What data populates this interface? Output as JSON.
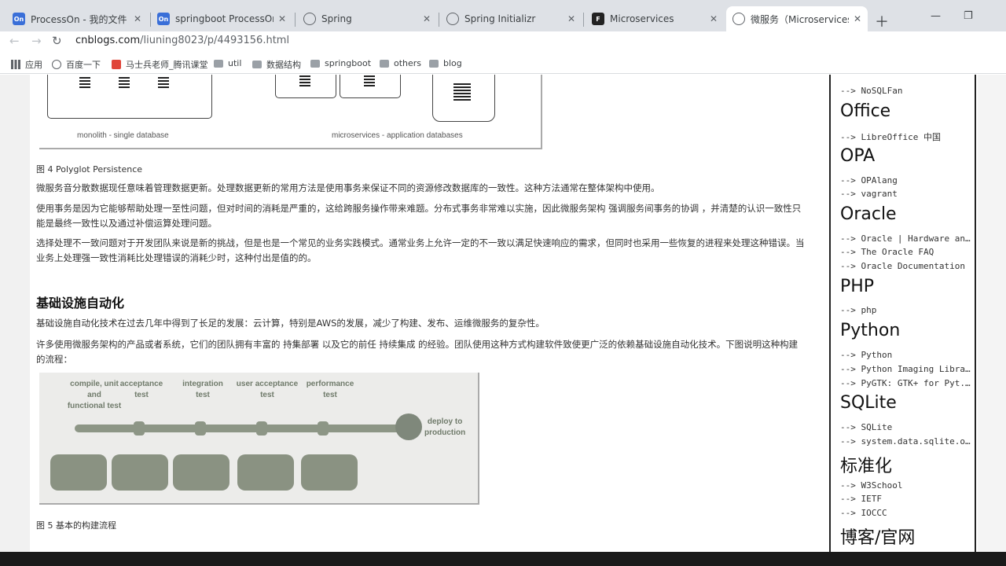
{
  "tabs": [
    {
      "title": "ProcessOn - 我的文件",
      "icon": "processon-icon"
    },
    {
      "title": "springboot ProcessOn Mi",
      "icon": "processon-icon"
    },
    {
      "title": "Spring",
      "icon": "globe-icon"
    },
    {
      "title": "Spring Initializr",
      "icon": "globe-icon"
    },
    {
      "title": "Microservices",
      "icon": "f-icon"
    },
    {
      "title": "微服务（Microservices）–",
      "icon": "globe-icon"
    }
  ],
  "address": {
    "host": "cnblogs.com",
    "path": "/liuning8023/p/4493156.html"
  },
  "bookmarks": [
    "应用",
    "百度一下",
    "马士兵老师_腾讯课堂",
    "util",
    "数据结构",
    "springboot",
    "others",
    "blog"
  ],
  "figure4": {
    "left_label": "monolith - single database",
    "right_label": "microservices - application databases",
    "caption": "图 4 Polyglot Persistence"
  },
  "paragraphs": [
    "微服务音分散数据现任意味着管理数据更新。处理数据更新的常用方法是使用事务来保证不同的资源修改数据库的一致性。这种方法通常在整体架构中使用。",
    "使用事务是因为它能够帮助处理一至性问题，但对时间的消耗是严重的，这给跨服务操作带来难题。分布式事务非常难以实施，因此微服务架构 强调服务间事务的协调 ，并清楚的认识一致性只能是最终一致性以及通过补偿运算处理问题。",
    "选择处理不一致问题对于开发团队来说是新的挑战，但是也是一个常见的业务实践模式。通常业务上允许一定的不一致以满足快速响应的需求，但同时也采用一些恢复的进程来处理这种错误。当业务上处理强一致性消耗比处理错误的消耗少时，这种付出是值的的。"
  ],
  "section": {
    "heading": "基础设施自动化",
    "para1": "基础设施自动化技术在过去几年中得到了长足的发展：云计算，特别是AWS的发展，减少了构建、发布、运维微服务的复杂性。",
    "para2": "许多使用微服务架构的产品或者系统，它们的团队拥有丰富的 持集部署 以及它的前任 持续集成 的经验。团队使用这种方式构建软件致使更广泛的依赖基础设施自动化技术。下图说明这种构建的流程："
  },
  "figure5": {
    "stages": [
      "compile, unit\nand\nfunctional test",
      "acceptance\ntest",
      "integration\ntest",
      "user acceptance\ntest",
      "performance\ntest"
    ],
    "deploy": "deploy to\nproduction",
    "caption": "图 5 基本的构建流程"
  },
  "sidebar": [
    {
      "type": "link",
      "text": "--> NoSQLFan"
    },
    {
      "type": "head",
      "text": "Office"
    },
    {
      "type": "link",
      "text": "--> LibreOffice 中国"
    },
    {
      "type": "head",
      "text": "OPA"
    },
    {
      "type": "link",
      "text": "--> OPAlang"
    },
    {
      "type": "link",
      "text": "--> vagrant"
    },
    {
      "type": "head",
      "text": "Oracle"
    },
    {
      "type": "link",
      "text": "--> Oracle | Hardware an..."
    },
    {
      "type": "link",
      "text": "--> The Oracle FAQ"
    },
    {
      "type": "link",
      "text": "--> Oracle Documentation"
    },
    {
      "type": "head",
      "text": "PHP"
    },
    {
      "type": "link",
      "text": "--> php"
    },
    {
      "type": "head",
      "text": "Python"
    },
    {
      "type": "link",
      "text": "--> Python"
    },
    {
      "type": "link",
      "text": "--> Python Imaging Libra..."
    },
    {
      "type": "link",
      "text": "--> PyGTK: GTK+ for Pyt..."
    },
    {
      "type": "head",
      "text": "SQLite"
    },
    {
      "type": "link",
      "text": "--> SQLite"
    },
    {
      "type": "link",
      "text": "--> system.data.sqlite.org"
    },
    {
      "type": "head",
      "text": "标准化"
    },
    {
      "type": "link",
      "text": "--> W3School"
    },
    {
      "type": "link",
      "text": "--> IETF"
    },
    {
      "type": "link",
      "text": "--> IOCCC"
    },
    {
      "type": "head",
      "text": "博客/官网"
    }
  ],
  "colors": {
    "tabbar": "#dee1e6",
    "pipeline": "#8d9686",
    "text": "#333333"
  }
}
